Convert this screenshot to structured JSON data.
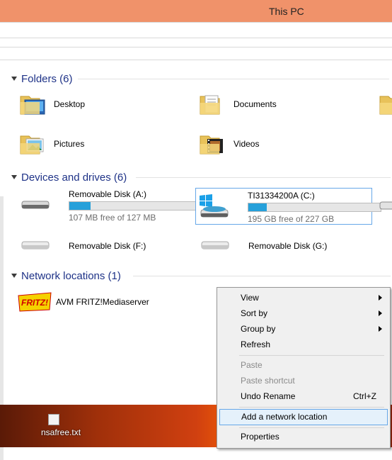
{
  "window": {
    "title": "This PC"
  },
  "groups": {
    "folders": {
      "header": "Folders (6)",
      "items": [
        "Desktop",
        "Documents",
        "Pictures",
        "Videos"
      ]
    },
    "devices": {
      "header": "Devices and drives (6)",
      "items": [
        {
          "name": "Removable Disk (A:)",
          "free": "107 MB free of 127 MB",
          "used_fraction": 0.16
        },
        {
          "name": "TI31334200A (C:)",
          "free": "195 GB free of 227 GB",
          "used_fraction": 0.14
        },
        {
          "name": "Removable Disk (F:)"
        },
        {
          "name": "Removable Disk (G:)"
        }
      ]
    },
    "network": {
      "header": "Network locations (1)",
      "items": [
        "AVM FRITZ!Mediaserver"
      ]
    }
  },
  "fritz_logo_text": "FRITZ!",
  "desktop": {
    "file": "nsafree.txt"
  },
  "context_menu": {
    "view": "View",
    "sort_by": "Sort by",
    "group_by": "Group by",
    "refresh": "Refresh",
    "paste": "Paste",
    "paste_shortcut": "Paste shortcut",
    "undo_rename": "Undo Rename",
    "undo_shortcut": "Ctrl+Z",
    "add_network_location": "Add a network location",
    "properties": "Properties"
  },
  "colors": {
    "titlebar": "#f0926a",
    "group_header": "#1e3287",
    "progress_fill": "#26a0da",
    "selection_border": "#66a7e8",
    "hover_bg": "#e5f1fb"
  }
}
